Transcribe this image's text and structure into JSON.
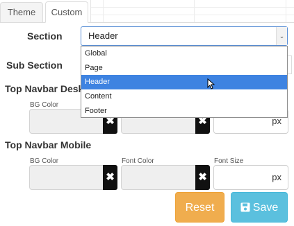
{
  "tabs": [
    {
      "label": "Theme"
    },
    {
      "label": "Custom"
    }
  ],
  "form": {
    "section_label": "Section",
    "section_value": "Header",
    "sub_section_label": "Sub Section",
    "top_navbar_desktop_label": "Top Navbar Desk",
    "top_navbar_mobile_label": "Top Navbar Mobile"
  },
  "dropdown": {
    "options": [
      "Global",
      "Page",
      "Header",
      "Content",
      "Footer"
    ],
    "selected": "Header"
  },
  "desktop": {
    "bg_color_label": "BG Color",
    "font_size_unit": "px"
  },
  "mobile": {
    "bg_color_label": "BG Color",
    "font_color_label": "Font Color",
    "font_size_label": "Font Size",
    "font_size_unit": "px"
  },
  "icons": {
    "clear": "✖"
  },
  "buttons": {
    "reset_label": "Reset",
    "save_label": "Save"
  },
  "colors": {
    "reset": "#f0ad4e",
    "save": "#5bc0de",
    "dropdown_highlight": "#3e83e1"
  }
}
